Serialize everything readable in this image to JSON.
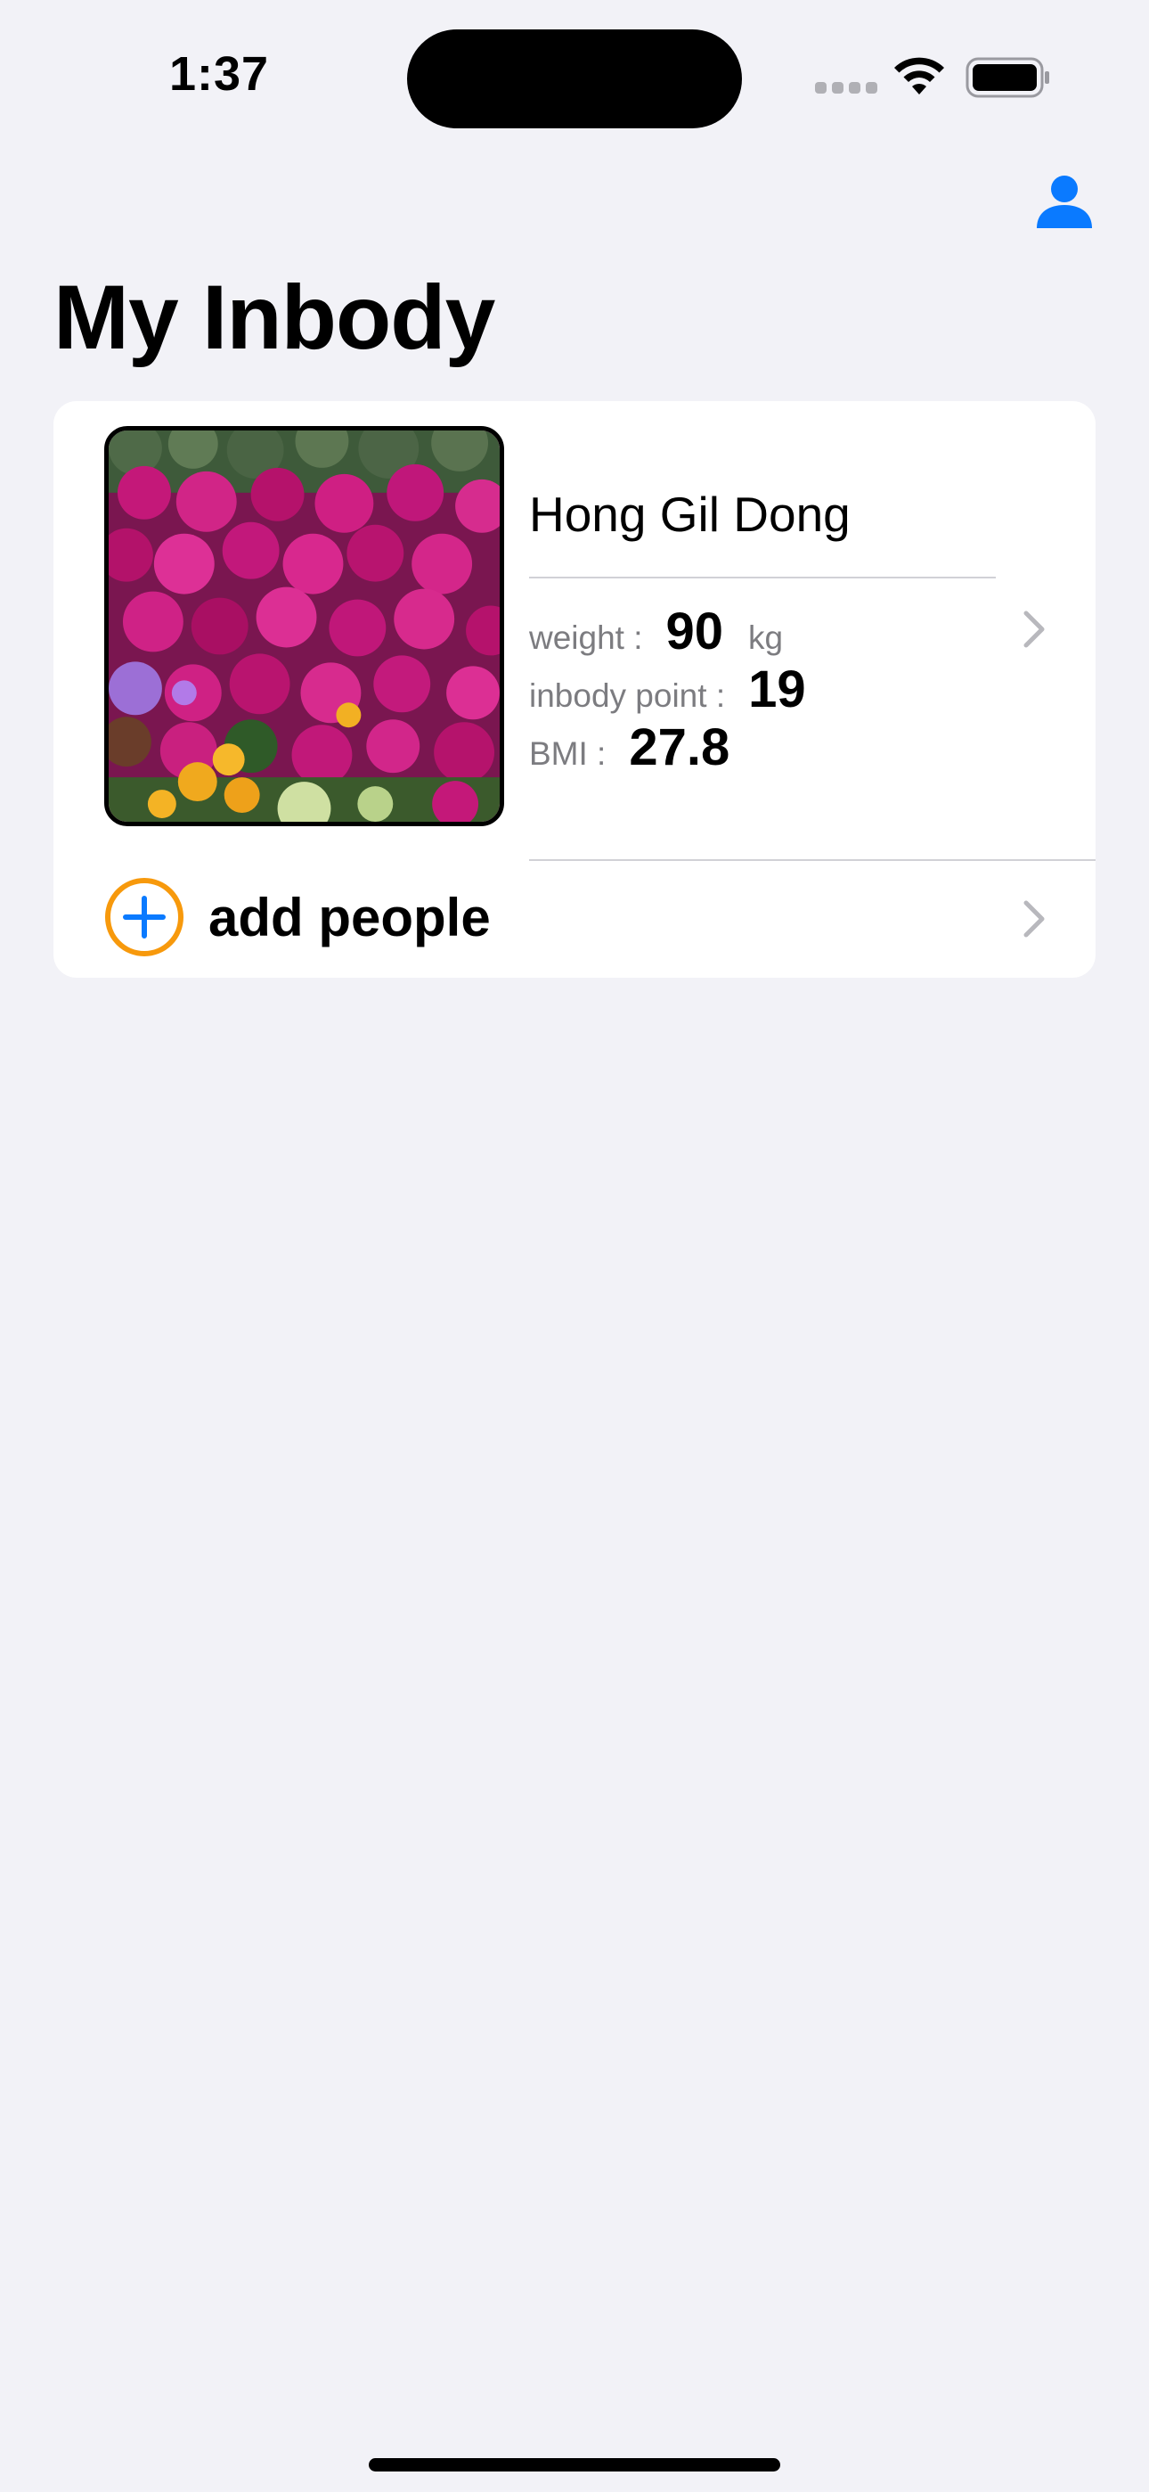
{
  "status_bar": {
    "time": "1:37"
  },
  "header": {
    "title": "My Inbody",
    "profile_icon": "person-icon"
  },
  "person": {
    "name": "Hong Gil Dong",
    "weight_label": "weight :",
    "weight_value": "90",
    "weight_unit": "kg",
    "inbody_point_label": "inbody point :",
    "inbody_point_value": "19",
    "bmi_label": "BMI :",
    "bmi_value": "27.8",
    "photo": "flower-field-photo"
  },
  "add_people": {
    "label": "add people",
    "icon": "plus-circle-icon"
  },
  "colors": {
    "accent_blue": "#0a7aff",
    "add_ring_orange": "#f7990c",
    "background": "#f2f2f7"
  }
}
